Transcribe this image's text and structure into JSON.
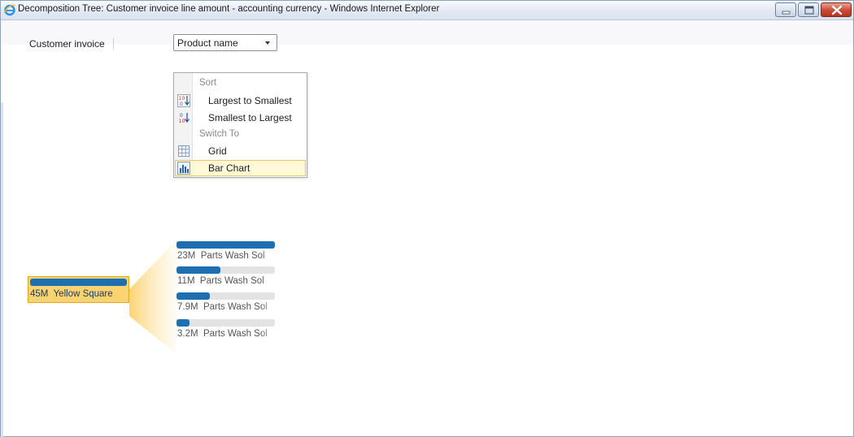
{
  "window": {
    "title": "Decomposition Tree: Customer invoice line amount - accounting currency - Windows Internet Explorer"
  },
  "toolbar": {
    "column_label": "Customer invoice",
    "dropdown_value": "Product name"
  },
  "menu": {
    "sort_header": "Sort",
    "switch_header": "Switch To",
    "items": [
      {
        "label": "Largest to Smallest",
        "icon": "sort-descending-icon"
      },
      {
        "label": "Smallest to Largest",
        "icon": "sort-ascending-icon"
      },
      {
        "label": "Grid",
        "icon": "grid-icon"
      },
      {
        "label": "Bar Chart",
        "icon": "bar-chart-icon",
        "selected": true
      }
    ]
  },
  "tree": {
    "root": {
      "value": "45M",
      "name": "Yellow Square"
    },
    "children": [
      {
        "value": "23M",
        "name": "Parts Wash Sol",
        "fraction": 1.0
      },
      {
        "value": "11M",
        "name": "Parts Wash Sol",
        "fraction": 0.45
      },
      {
        "value": "7.9M",
        "name": "Parts Wash Sol",
        "fraction": 0.34
      },
      {
        "value": "3.2M",
        "name": "Parts Wash Sol",
        "fraction": 0.13
      }
    ]
  },
  "colors": {
    "bar_fill": "#1d6fb1",
    "bar_track": "#e3e3e3",
    "root_highlight": "#fbd470",
    "menu_selected": "#fff8d9"
  }
}
